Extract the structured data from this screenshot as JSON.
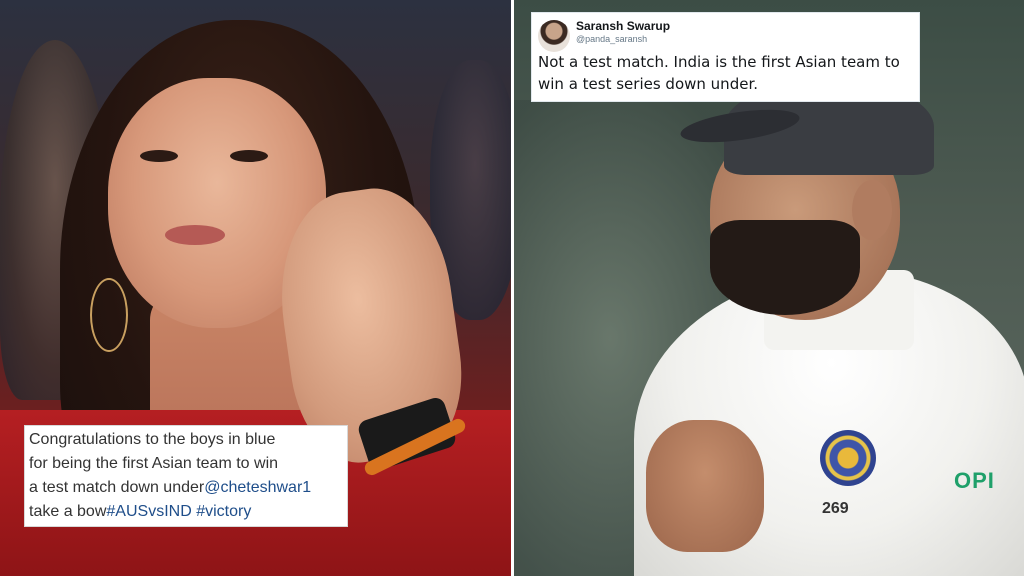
{
  "left_image": {
    "caption_lines": [
      {
        "text": "Congratulations to the boys in blue",
        "tags": []
      },
      {
        "text": "for being the first Asian team to win",
        "tags": []
      },
      {
        "text": "a test match down under",
        "tags": [
          "@cheteshwar1"
        ]
      },
      {
        "text": "take a bow",
        "tags": [
          "#AUSvsIND",
          " #victory"
        ]
      }
    ]
  },
  "right_image": {
    "tweet": {
      "display_name": "Saransh Swarup",
      "handle": "@panda_saransh",
      "text": "Not a test match. India is the first Asian team to win a test series down under."
    },
    "jersey": {
      "sponsor": "OPI",
      "number": "269"
    }
  }
}
